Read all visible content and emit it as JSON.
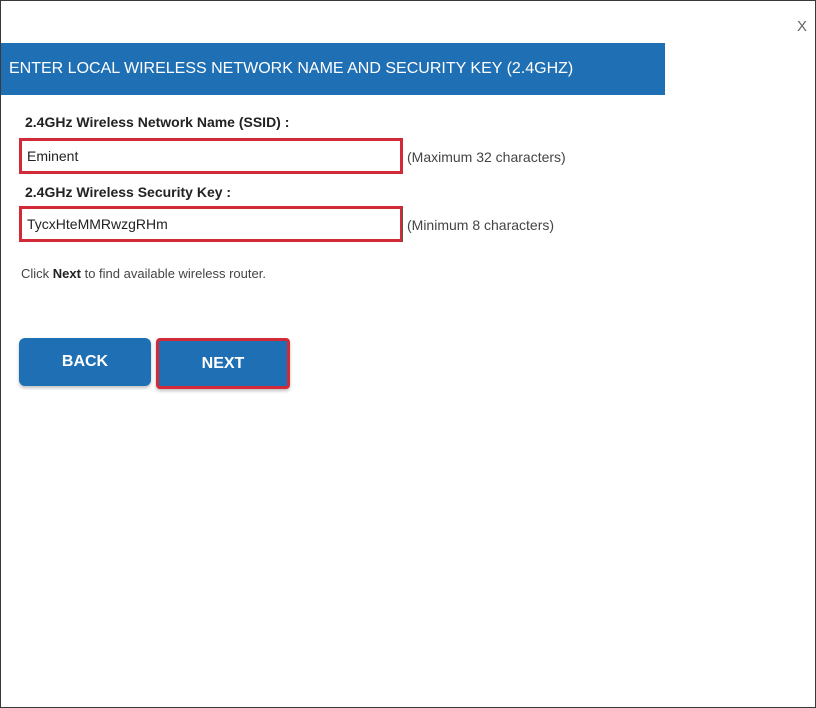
{
  "dialog": {
    "close_label": "X",
    "title": "ENTER LOCAL WIRELESS NETWORK NAME AND SECURITY KEY (2.4GHZ)"
  },
  "form": {
    "ssid_label": "2.4GHz Wireless Network Name (SSID) :",
    "ssid_value": "Eminent",
    "ssid_hint": "(Maximum 32 characters)",
    "key_label": "2.4GHz Wireless Security Key :",
    "key_value": "TycxHteMMRwzgRHm",
    "key_hint": "(Minimum 8 characters)"
  },
  "info": {
    "prefix": "Click ",
    "bold": "Next",
    "suffix": " to find available wireless router."
  },
  "buttons": {
    "back_label": "BACK",
    "next_label": "NEXT"
  },
  "colors": {
    "accent": "#1f6fb4",
    "highlight_border": "#d22a36"
  }
}
